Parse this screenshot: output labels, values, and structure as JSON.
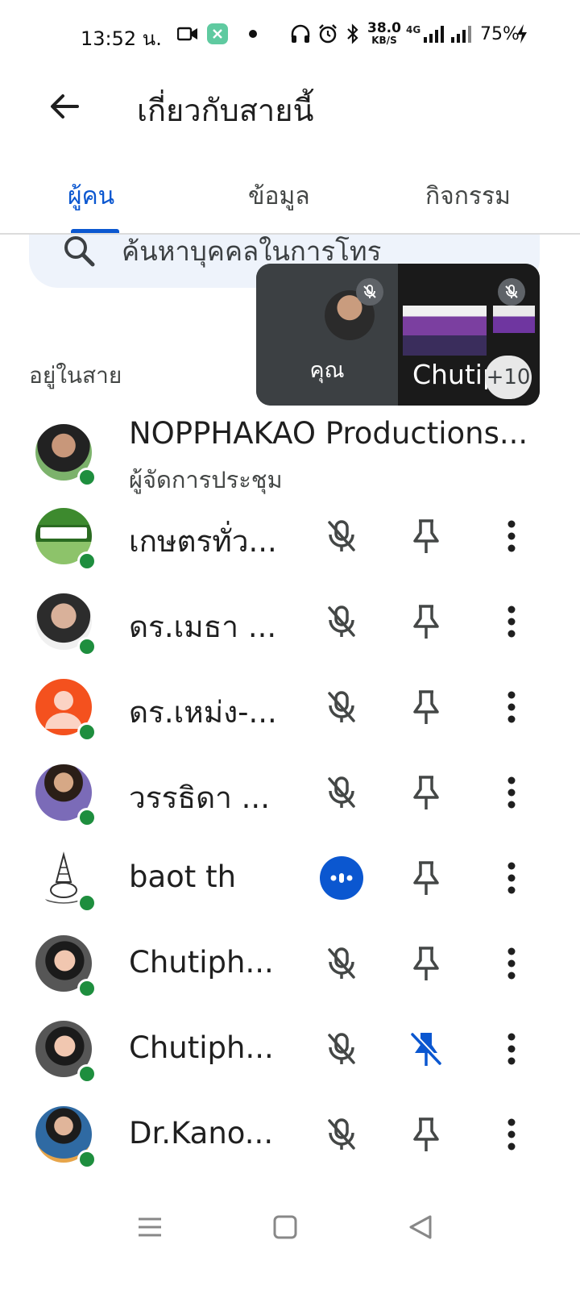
{
  "status_bar": {
    "time": "13:52 น.",
    "net_speed_value": "38.0",
    "net_speed_unit": "KB/S",
    "network_type": "4G",
    "battery": "75%"
  },
  "header": {
    "title": "เกี่ยวกับสายนี้"
  },
  "tabs": [
    {
      "label": "ผู้คน",
      "active": true
    },
    {
      "label": "ข้อมูล",
      "active": false
    },
    {
      "label": "กิจกรรม",
      "active": false
    }
  ],
  "search": {
    "placeholder": "ค้นหาบุคคลในการโทร"
  },
  "preview": {
    "self_label": "คุณ",
    "other_name": "Chutiph",
    "more_count": "+10"
  },
  "section_label": "อยู่ในสาย",
  "participants": [
    {
      "name": "NOPPHAKAO Productions...",
      "role": "ผู้จัดการประชุม",
      "mic": "none",
      "pinned": false
    },
    {
      "name": "เกษตรทั่ว...",
      "mic": "off",
      "pinned": false
    },
    {
      "name": "ดร.เมธา ...",
      "mic": "off",
      "pinned": false
    },
    {
      "name": "ดร.เหม่ง-...",
      "mic": "off",
      "pinned": false
    },
    {
      "name": "วรรธิดา ...",
      "mic": "off",
      "pinned": false
    },
    {
      "name": "baot th",
      "mic": "speaking",
      "pinned": false
    },
    {
      "name": "Chutiph...",
      "mic": "off",
      "pinned": false
    },
    {
      "name": "Chutiph...",
      "mic": "off",
      "pinned": true
    },
    {
      "name": "Dr.Kano...",
      "mic": "off",
      "pinned": false
    }
  ],
  "colors": {
    "accent": "#0b57d0",
    "online": "#1e8e3e",
    "search_bg": "#eef3fb",
    "icon": "#444746"
  }
}
